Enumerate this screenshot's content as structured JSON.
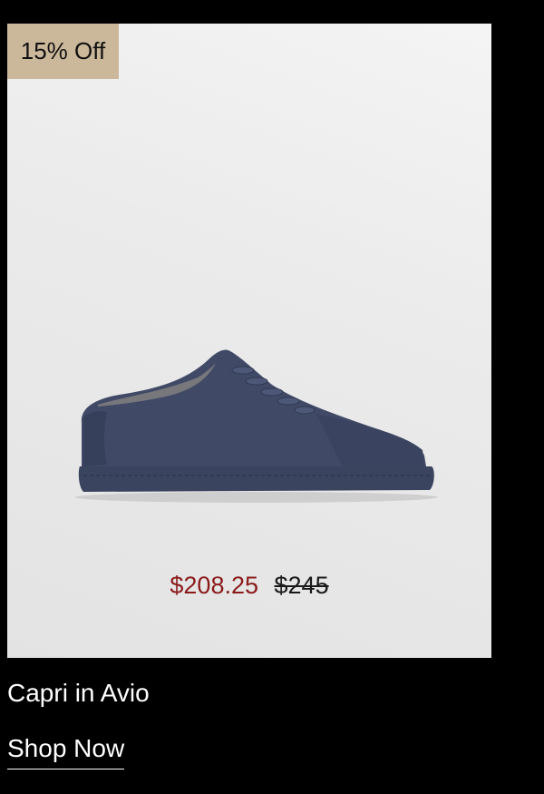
{
  "product": {
    "badge": "15% Off",
    "image_alt": "navy suede low-top sneaker",
    "sale_price": "$208.25",
    "original_price": "$245",
    "name": "Capri in Avio",
    "cta": "Shop Now"
  },
  "colors": {
    "background": "#000000",
    "badge": "#cbb89a",
    "sale_price": "#8b1a1a",
    "shoe": "#3f4a66"
  }
}
